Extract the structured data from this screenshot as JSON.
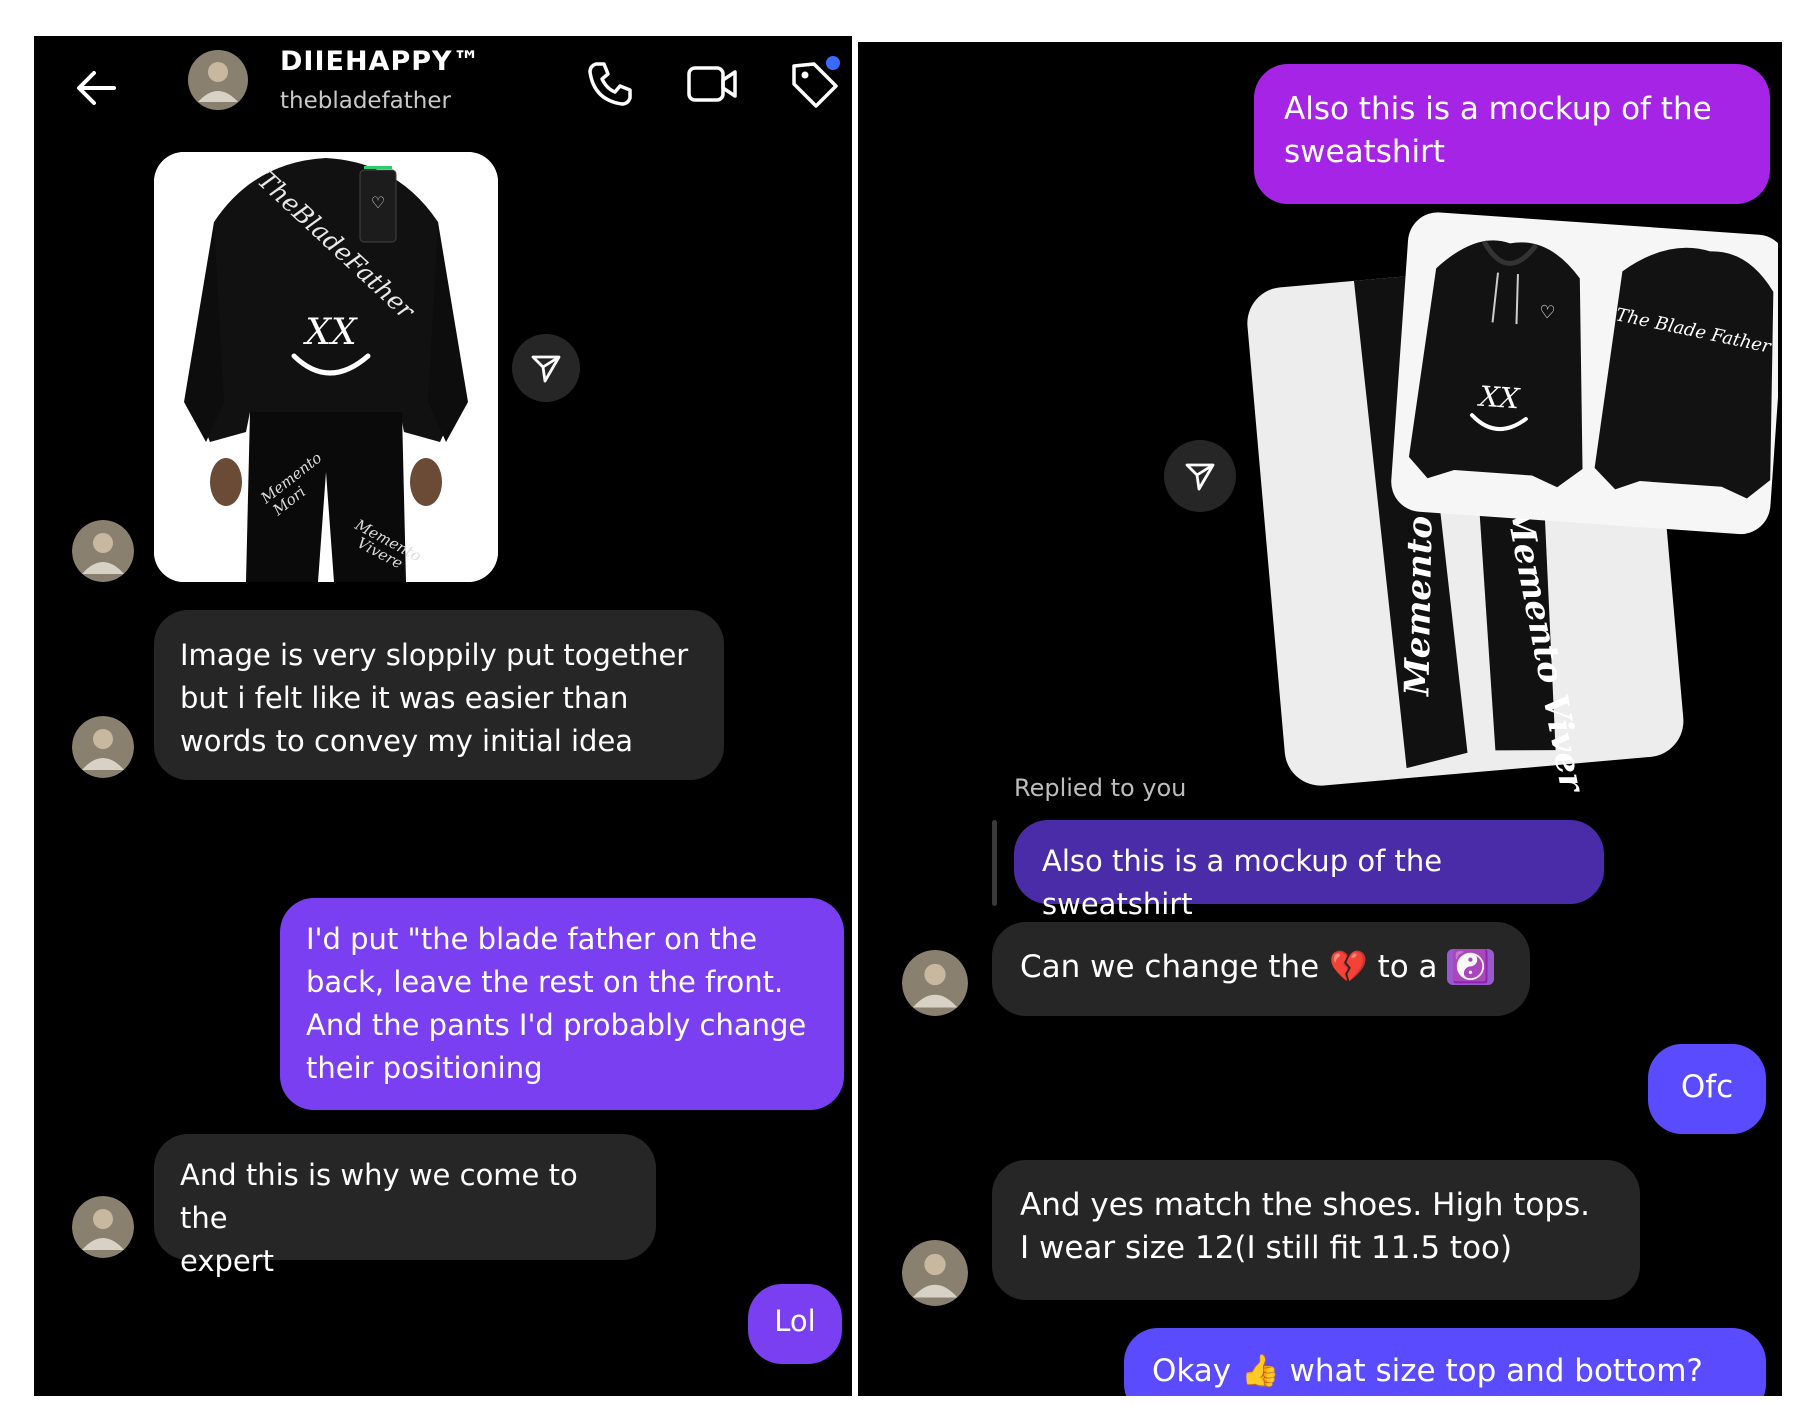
{
  "header": {
    "contact_name": "DIIEHAPPY™",
    "username": "thebladefather",
    "icons": [
      "back-arrow-icon",
      "phone-icon",
      "video-camera-icon",
      "tag-icon"
    ]
  },
  "left_thread": {
    "image_post": {
      "texts": [
        "TheBladeFather",
        "XX",
        "Memento Mori",
        "Memento Vivere"
      ]
    },
    "messages": [
      {
        "sender": "contact",
        "lines": [
          "Image is very sloppily put together",
          "but i felt like it was easier than",
          "words to convey my initial idea"
        ]
      },
      {
        "sender": "me",
        "lines": [
          "I'd put \"the blade father on the",
          "back, leave the rest on the front.",
          "And the pants I'd probably change",
          "their positioning"
        ]
      },
      {
        "sender": "contact",
        "lines": [
          "And this is why we come to the",
          "expert"
        ]
      },
      {
        "sender": "me",
        "lines": [
          "Lol"
        ]
      }
    ]
  },
  "right_thread": {
    "messages_top": {
      "sender": "me",
      "lines": [
        "Also this is a mockup of the",
        "sweatshirt"
      ]
    },
    "mockup_image": {
      "texts": [
        "The Blade Father",
        "XX",
        "Memento Mori",
        "Memento Vivere"
      ]
    },
    "reply_label": "Replied to you",
    "quoted_message": "Also this is a mockup of the sweatshirt",
    "msg_change": {
      "before": "Can we change the",
      "emoji1": "💔",
      "middle": "to a",
      "emoji2": "☯️"
    },
    "msg_ofc": "Ofc",
    "msg_shoes": [
      "And yes match the shoes. High tops.",
      "I wear size 12(I still fit 11.5 too)"
    ],
    "msg_last": {
      "before": "Okay",
      "emoji": "👍",
      "after": "what size top and bottom?"
    }
  },
  "colors": {
    "background": "#000000",
    "incoming_bubble": "#262626",
    "outgoing_purple": "#7b3ff2",
    "outgoing_violet": "#a524e6",
    "outgoing_blue": "#5b4bff",
    "unread_dot": "#3a6bff"
  }
}
